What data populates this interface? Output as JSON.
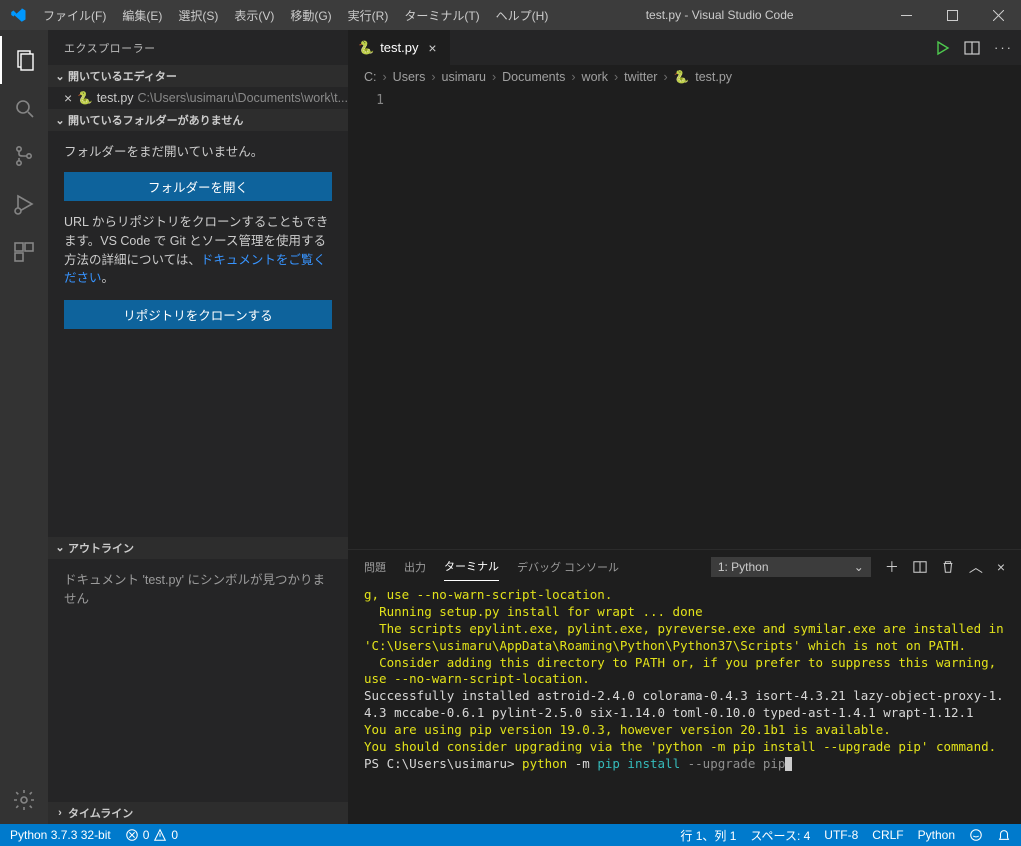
{
  "window": {
    "title": "test.py - Visual Studio Code"
  },
  "menubar": [
    "ファイル(F)",
    "編集(E)",
    "選択(S)",
    "表示(V)",
    "移動(G)",
    "実行(R)",
    "ターミナル(T)",
    "ヘルプ(H)"
  ],
  "sidebar": {
    "title": "エクスプローラー",
    "open_editors_header": "開いているエディター",
    "open_editor": {
      "name": "test.py",
      "path": "C:\\Users\\usimaru\\Documents\\work\\t..."
    },
    "no_folder_header": "開いているフォルダーがありません",
    "nofolder_text": "フォルダーをまだ開いていません。",
    "open_folder_btn": "フォルダーを開く",
    "clone_desc_pre": "URL からリポジトリをクローンすることもできます。VS Code で Git とソース管理を使用する方法の詳細については、",
    "clone_desc_link": "ドキュメントをご覧ください",
    "clone_desc_post": "。",
    "clone_btn": "リポジトリをクローンする",
    "outline_header": "アウトライン",
    "outline_msg": "ドキュメント 'test.py' にシンボルが見つかりません",
    "timeline_header": "タイムライン"
  },
  "tab": {
    "name": "test.py"
  },
  "breadcrumb": [
    "C:",
    "Users",
    "usimaru",
    "Documents",
    "work",
    "twitter",
    "test.py"
  ],
  "editor": {
    "line_number": "1"
  },
  "panel": {
    "tabs": {
      "problems": "問題",
      "output": "出力",
      "terminal": "ターミナル",
      "debug": "デバッグ コンソール"
    },
    "terminal_select": "1: Python"
  },
  "terminal": {
    "l1": "g, use --no-warn-script-location.",
    "l2": "  Running setup.py install for wrapt ... done",
    "l3": "  The scripts epylint.exe, pylint.exe, pyreverse.exe and symilar.exe are installed in 'C:\\Users\\usimaru\\AppData\\Roaming\\Python\\Python37\\Scripts' which is not on PATH.",
    "l4": "  Consider adding this directory to PATH or, if you prefer to suppress this warning, use --no-warn-script-location.",
    "l5": "Successfully installed astroid-2.4.0 colorama-0.4.3 isort-4.3.21 lazy-object-proxy-1.4.3 mccabe-0.6.1 pylint-2.5.0 six-1.14.0 toml-0.10.0 typed-ast-1.4.1 wrapt-1.12.1",
    "l6": "You are using pip version 19.0.3, however version 20.1b1 is available.",
    "l7": "You should consider upgrading via the 'python -m pip install --upgrade pip' command.",
    "prompt_pre": "PS C:\\Users\\usimaru> ",
    "prompt_cmd1": "python",
    "prompt_cmd2": " -m ",
    "prompt_cmd3": "pip install ",
    "prompt_cmd4": "--upgrade pip"
  },
  "statusbar": {
    "python": "Python 3.7.3 32-bit",
    "errors": "0",
    "warnings": "0",
    "ln_col": "行 1、列 1",
    "spaces": "スペース: 4",
    "encoding": "UTF-8",
    "eol": "CRLF",
    "lang": "Python"
  }
}
